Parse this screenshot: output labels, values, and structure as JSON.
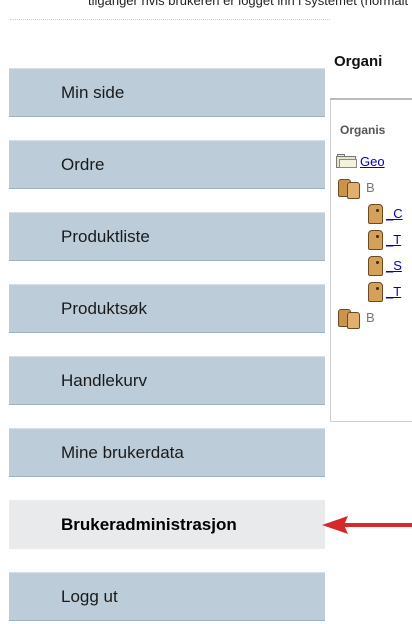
{
  "page": {
    "top_text": "tilganger hvis brukeren er logget inn i systemet (normalt logget på)."
  },
  "sidebar": {
    "items": [
      {
        "label": "Min side",
        "active": false
      },
      {
        "label": "Ordre",
        "active": false
      },
      {
        "label": "Produktliste",
        "active": false
      },
      {
        "label": "Produktsøk",
        "active": false
      },
      {
        "label": "Handlekurv",
        "active": false
      },
      {
        "label": "Mine brukerdata",
        "active": false
      },
      {
        "label": "Brukeradministrasjon",
        "active": true
      },
      {
        "label": "Logg ut",
        "active": false
      }
    ]
  },
  "annotation": {
    "arrow_color": "#d42a2a"
  },
  "content": {
    "title": "Organi",
    "subheading": "Organis",
    "tree": [
      {
        "type": "folder",
        "label": "Geo"
      },
      {
        "type": "group",
        "label": "B"
      },
      {
        "type": "user",
        "label": "_C"
      },
      {
        "type": "user",
        "label": "_T"
      },
      {
        "type": "user",
        "label": "_S"
      },
      {
        "type": "user",
        "label": "_T"
      },
      {
        "type": "group",
        "label": "B"
      }
    ]
  },
  "colors": {
    "menu_bg": "#bcccd8",
    "menu_active_bg": "#e8eaeb",
    "link": "#0000cc"
  }
}
